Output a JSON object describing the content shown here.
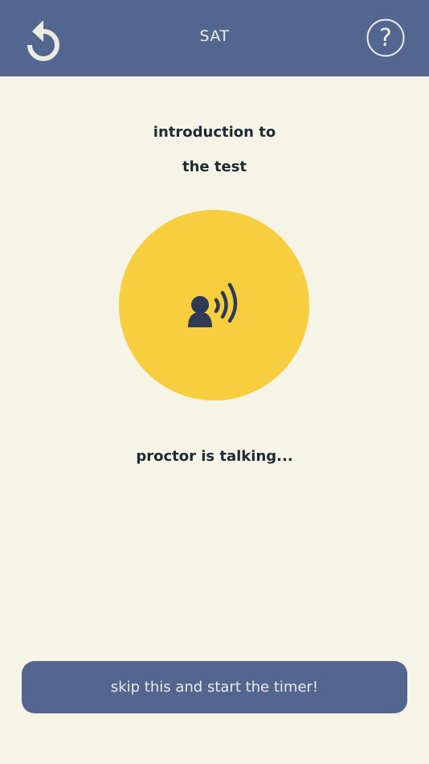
{
  "header": {
    "title": "SAT",
    "restart_icon": "restart-icon",
    "help_icon": "help-question-icon",
    "help_glyph": "?"
  },
  "main": {
    "intro_line_1": "introduction to",
    "intro_line_2": "the test",
    "speaker_icon": "person-speaking-icon",
    "status": "proctor is talking..."
  },
  "footer": {
    "skip_label": "skip this and start the timer!"
  },
  "colors": {
    "header_bg": "#536690",
    "page_bg": "#f5f4e7",
    "circle_accent": "#f6ce40",
    "text_dark": "#1e2b33",
    "text_light": "#ecebe3"
  }
}
